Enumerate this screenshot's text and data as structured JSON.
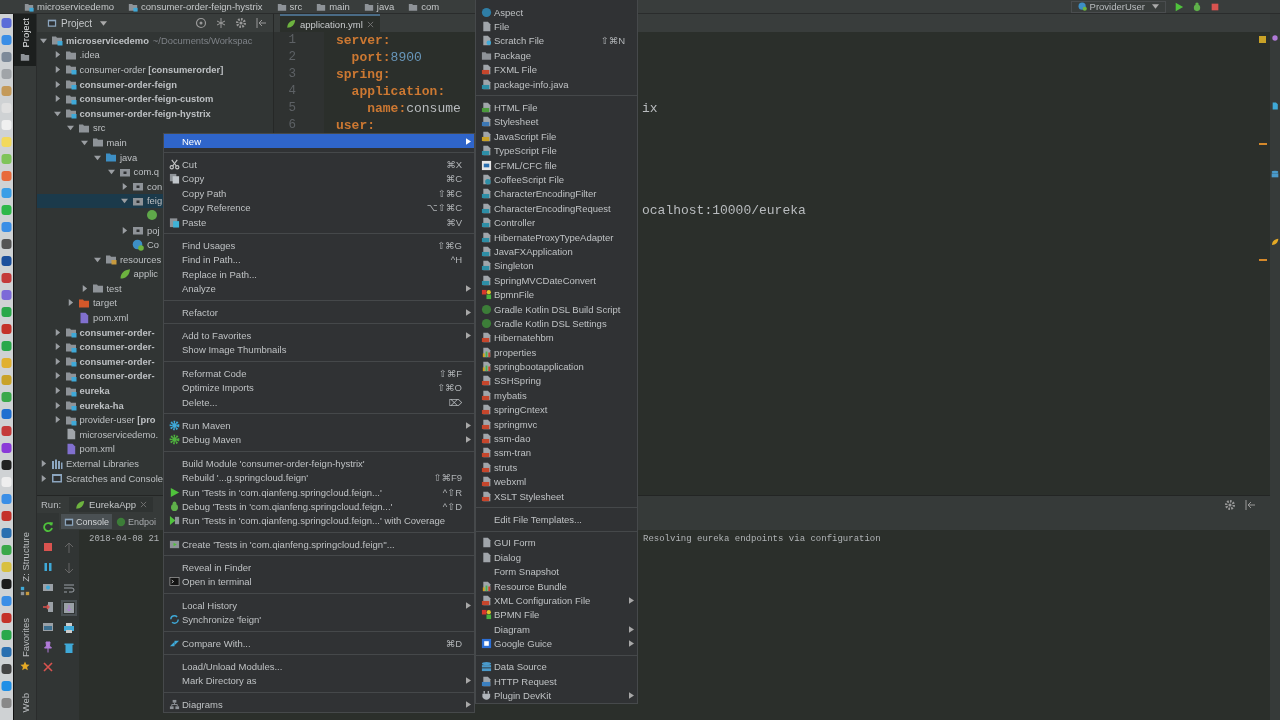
{
  "nav_bar": {
    "breadcrumbs": [
      "microservicedemo",
      "consumer-order-feign-hystrix",
      "src",
      "main",
      "java",
      "com"
    ],
    "run_config": "ProviderUser"
  },
  "left_stripe": {
    "top_tabs": [
      {
        "label": "Project",
        "selected": true
      }
    ],
    "bottom_tabs": [
      {
        "label": "Z: Structure",
        "selected": false
      },
      {
        "label": "Favorites",
        "selected": false
      },
      {
        "label": "Web",
        "selected": false
      }
    ]
  },
  "project_panel": {
    "title": "Project",
    "tree": [
      {
        "label": "microservicedemo",
        "path": "~/Documents/Workspac",
        "kind": "module",
        "bold": true,
        "expanded": true,
        "selected": false,
        "children": [
          {
            "label": ".idea",
            "kind": "folder",
            "bold": false,
            "expanded": false,
            "selected": false
          },
          {
            "label": "consumer-order **[consumerorder]**",
            "kind": "module",
            "bold": false,
            "expanded": false,
            "selected": false
          },
          {
            "label": "consumer-order-feign",
            "kind": "module",
            "bold": true,
            "expanded": false,
            "selected": false
          },
          {
            "label": "consumer-order-feign-custom",
            "kind": "module",
            "bold": true,
            "expanded": false,
            "selected": false
          },
          {
            "label": "consumer-order-feign-hystrix",
            "kind": "module",
            "bold": true,
            "expanded": true,
            "selected": false,
            "children": [
              {
                "label": "src",
                "kind": "folder",
                "bold": false,
                "expanded": true,
                "selected": false,
                "children": [
                  {
                    "label": "main",
                    "kind": "folder",
                    "bold": false,
                    "expanded": true,
                    "selected": false,
                    "children": [
                      {
                        "label": "java",
                        "kind": "source",
                        "bold": false,
                        "expanded": true,
                        "selected": false,
                        "children": [
                          {
                            "label": "com.q",
                            "kind": "package",
                            "bold": false,
                            "expanded": true,
                            "selected": false,
                            "children": [
                              {
                                "label": "con",
                                "kind": "package",
                                "bold": false,
                                "expanded": false,
                                "selected": false
                              },
                              {
                                "label": "feig",
                                "kind": "package",
                                "bold": false,
                                "expanded": true,
                                "selected": true,
                                "children": [
                                  {
                                    "kind": "interface",
                                    "selected": false
                                  }
                                ]
                              },
                              {
                                "label": "poj",
                                "kind": "package",
                                "bold": false,
                                "expanded": false,
                                "selected": false
                              },
                              {
                                "label": "Co",
                                "kind": "class",
                                "bold": false,
                                "selected": false
                              }
                            ]
                          }
                        ]
                      },
                      {
                        "label": "resources",
                        "kind": "resources",
                        "bold": false,
                        "expanded": true,
                        "selected": false,
                        "children": [
                          {
                            "label": "applic",
                            "kind": "config",
                            "bold": false,
                            "selected": false
                          }
                        ]
                      }
                    ]
                  },
                  {
                    "label": "test",
                    "kind": "folder",
                    "bold": false,
                    "expanded": false,
                    "selected": false
                  }
                ]
              },
              {
                "label": "target",
                "kind": "excluded",
                "bold": false,
                "expanded": false,
                "selected": false
              },
              {
                "label": "pom.xml",
                "kind": "maven",
                "bold": false,
                "selected": false
              }
            ]
          },
          {
            "label": "consumer-order-",
            "kind": "module",
            "bold": true,
            "expanded": false,
            "selected": false
          },
          {
            "label": "consumer-order-",
            "kind": "module",
            "bold": true,
            "expanded": false,
            "selected": false
          },
          {
            "label": "consumer-order-",
            "kind": "module",
            "bold": true,
            "expanded": false,
            "selected": false
          },
          {
            "label": "consumer-order-",
            "kind": "module",
            "bold": true,
            "expanded": false,
            "selected": false
          },
          {
            "label": "eureka",
            "kind": "module",
            "bold": true,
            "expanded": false,
            "selected": false
          },
          {
            "label": "eureka-ha",
            "kind": "module",
            "bold": true,
            "expanded": false,
            "selected": false
          },
          {
            "label": "provider-user **[pro**",
            "kind": "module",
            "bold": false,
            "expanded": false,
            "selected": false
          },
          {
            "label": "microservicedemo.",
            "kind": "iml",
            "bold": false,
            "selected": false
          },
          {
            "label": "pom.xml",
            "kind": "maven",
            "bold": false,
            "selected": false
          }
        ]
      },
      {
        "label": "External Libraries",
        "kind": "libraries",
        "bold": false,
        "expanded": false,
        "selected": false
      },
      {
        "label": "Scratches and Console",
        "kind": "scratches",
        "bold": false,
        "expanded": false,
        "selected": false
      }
    ]
  },
  "editor": {
    "tabs": [
      {
        "label": "application.yml",
        "selected": true
      }
    ],
    "lines": [
      {
        "number": "1",
        "key": "server:"
      },
      {
        "number": "2",
        "kind": "number",
        "key": "  port:",
        "value": "8900"
      },
      {
        "number": "3",
        "key": "spring:"
      },
      {
        "number": "4",
        "key": "  application:"
      },
      {
        "number": "5",
        "kind": "text",
        "key": "    name:",
        "value": "consume"
      },
      {
        "number": "6",
        "key": "user:"
      }
    ],
    "right_fragments": [
      "ix",
      "ocalhost:10000/eureka"
    ]
  },
  "run_panel": {
    "label": "Run:",
    "tabs": [
      {
        "label": "EurekaApp",
        "selected": true
      }
    ],
    "console_tabs": [
      {
        "label": "Console",
        "selected": true
      },
      {
        "label": "Endpoi",
        "selected": false
      }
    ],
    "console_lines": [
      {
        "left": "2018-04-08 21",
        "right": "Resolving eureka endpoints via configuration"
      }
    ]
  },
  "context_menu": {
    "items": [
      {
        "kind": "plain",
        "label": "New",
        "selected": true,
        "submenu": true
      },
      {
        "kind": "separator"
      },
      {
        "kind": "cut",
        "label": "Cut",
        "shortcut": "⌘X",
        "selected": false,
        "submenu": false
      },
      {
        "kind": "copy",
        "label": "Copy",
        "shortcut": "⌘C",
        "selected": false,
        "submenu": false
      },
      {
        "kind": "plain",
        "label": "Copy Path",
        "shortcut": "⇧⌘C",
        "selected": false,
        "submenu": false
      },
      {
        "kind": "plain",
        "label": "Copy Reference",
        "shortcut": "⌥⇧⌘C",
        "selected": false,
        "submenu": false
      },
      {
        "kind": "paste",
        "label": "Paste",
        "shortcut": "⌘V",
        "selected": false,
        "submenu": false
      },
      {
        "kind": "separator"
      },
      {
        "kind": "plain",
        "label": "Find Usages",
        "shortcut": "⇧⌘G",
        "selected": false,
        "submenu": false
      },
      {
        "kind": "plain",
        "label": "Find in Path...",
        "shortcut": "^H",
        "selected": false,
        "submenu": false
      },
      {
        "kind": "plain",
        "label": "Replace in Path...",
        "selected": false,
        "submenu": false
      },
      {
        "kind": "plain",
        "label": "Analyze",
        "selected": false,
        "submenu": true
      },
      {
        "kind": "separator"
      },
      {
        "kind": "plain",
        "label": "Refactor",
        "selected": false,
        "submenu": true
      },
      {
        "kind": "separator"
      },
      {
        "kind": "plain",
        "label": "Add to Favorites",
        "selected": false,
        "submenu": true
      },
      {
        "kind": "plain",
        "label": "Show Image Thumbnails",
        "selected": false,
        "submenu": false
      },
      {
        "kind": "separator"
      },
      {
        "kind": "plain",
        "label": "Reformat Code",
        "shortcut": "⇧⌘F",
        "selected": false,
        "submenu": false
      },
      {
        "kind": "plain",
        "label": "Optimize Imports",
        "shortcut": "⇧⌘O",
        "selected": false,
        "submenu": false
      },
      {
        "kind": "plain",
        "label": "Delete...",
        "shortcut": "⌦",
        "selected": false,
        "submenu": false
      },
      {
        "kind": "separator"
      },
      {
        "kind": "maven-run",
        "label": "Run Maven",
        "selected": false,
        "submenu": true
      },
      {
        "kind": "maven-debug",
        "label": "Debug Maven",
        "selected": false,
        "submenu": true
      },
      {
        "kind": "separator"
      },
      {
        "kind": "plain",
        "label": "Build Module 'consumer-order-feign-hystrix'",
        "selected": false,
        "submenu": false
      },
      {
        "kind": "plain",
        "label": "Rebuild '...g.springcloud.feign'",
        "shortcut": "⇧⌘F9",
        "selected": false,
        "submenu": false
      },
      {
        "kind": "run",
        "label": "Run 'Tests in 'com.qianfeng.springcloud.feign...'",
        "shortcut": "^⇧R",
        "selected": false,
        "submenu": false
      },
      {
        "kind": "debug",
        "label": "Debug 'Tests in 'com.qianfeng.springcloud.feign...'",
        "shortcut": "^⇧D",
        "selected": false,
        "submenu": false
      },
      {
        "kind": "coverage",
        "label": "Run 'Tests in 'com.qianfeng.springcloud.feign...' with Coverage",
        "selected": false,
        "submenu": false
      },
      {
        "kind": "separator"
      },
      {
        "kind": "test",
        "label": "Create 'Tests in 'com.qianfeng.springcloud.feign''...",
        "selected": false,
        "submenu": false
      },
      {
        "kind": "separator"
      },
      {
        "kind": "plain",
        "label": "Reveal in Finder",
        "selected": false,
        "submenu": false
      },
      {
        "kind": "terminal",
        "label": "Open in terminal",
        "selected": false,
        "submenu": false
      },
      {
        "kind": "separator"
      },
      {
        "kind": "plain",
        "label": "Local History",
        "selected": false,
        "submenu": true
      },
      {
        "kind": "sync",
        "label": "Synchronize 'feign'",
        "selected": false,
        "submenu": false
      },
      {
        "kind": "separator"
      },
      {
        "kind": "compare",
        "label": "Compare With...",
        "shortcut": "⌘D",
        "selected": false,
        "submenu": false
      },
      {
        "kind": "separator"
      },
      {
        "kind": "plain",
        "label": "Load/Unload Modules...",
        "selected": false,
        "submenu": false
      },
      {
        "kind": "plain",
        "label": "Mark Directory as",
        "selected": false,
        "submenu": true
      },
      {
        "kind": "separator"
      },
      {
        "kind": "diagram",
        "label": "Diagrams",
        "selected": false,
        "submenu": true
      }
    ]
  },
  "new_submenu": {
    "items": [
      {
        "kind": "aspect",
        "label": "Aspect",
        "selected": false,
        "submenu": false
      },
      {
        "kind": "file",
        "label": "File",
        "selected": false,
        "submenu": false
      },
      {
        "kind": "scratch",
        "label": "Scratch File",
        "shortcut": "⇧⌘N",
        "selected": false,
        "submenu": false
      },
      {
        "kind": "folder",
        "label": "Package",
        "selected": false,
        "submenu": false
      },
      {
        "kind": "tpl-red",
        "label": "FXML File",
        "selected": false,
        "submenu": false
      },
      {
        "kind": "tpl-teal",
        "label": "package-info.java",
        "selected": false,
        "submenu": false
      },
      {
        "kind": "separator"
      },
      {
        "kind": "tpl-green",
        "label": "HTML File",
        "selected": false,
        "submenu": false
      },
      {
        "kind": "tpl-blue",
        "label": "Stylesheet",
        "selected": false,
        "submenu": false
      },
      {
        "kind": "tpl-yellow",
        "label": "JavaScript File",
        "selected": false,
        "submenu": false
      },
      {
        "kind": "tpl-teal",
        "label": "TypeScript File",
        "selected": false,
        "submenu": false
      },
      {
        "kind": "cf",
        "label": "CFML/CFC file",
        "selected": false,
        "submenu": false
      },
      {
        "kind": "coffee",
        "label": "CoffeeScript File",
        "selected": false,
        "submenu": false
      },
      {
        "kind": "tpl-teal",
        "label": "CharacterEncodingFilter",
        "selected": false,
        "submenu": false
      },
      {
        "kind": "tpl-teal",
        "label": "CharacterEncodingRequest",
        "selected": false,
        "submenu": false
      },
      {
        "kind": "tpl-teal",
        "label": "Controller",
        "selected": false,
        "submenu": false
      },
      {
        "kind": "tpl-teal",
        "label": "HibernateProxyTypeAdapter",
        "selected": false,
        "submenu": false
      },
      {
        "kind": "tpl-teal",
        "label": "JavaFXApplication",
        "selected": false,
        "submenu": false
      },
      {
        "kind": "tpl-teal",
        "label": "Singleton",
        "selected": false,
        "submenu": false
      },
      {
        "kind": "tpl-teal",
        "label": "SpringMVCDateConvert",
        "selected": false,
        "submenu": false
      },
      {
        "kind": "bpmn",
        "label": "BpmnFile",
        "selected": false,
        "submenu": false
      },
      {
        "kind": "gradle",
        "label": "Gradle Kotlin DSL Build Script",
        "selected": false,
        "submenu": false
      },
      {
        "kind": "gradle",
        "label": "Gradle Kotlin DSL Settings",
        "selected": false,
        "submenu": false
      },
      {
        "kind": "tpl-red",
        "label": "Hibernatehbm",
        "selected": false,
        "submenu": false
      },
      {
        "kind": "tpl-chart",
        "label": "properties",
        "selected": false,
        "submenu": false
      },
      {
        "kind": "tpl-chart",
        "label": "springbootapplication",
        "selected": false,
        "submenu": false
      },
      {
        "kind": "tpl-red",
        "label": "SSHSpring",
        "selected": false,
        "submenu": false
      },
      {
        "kind": "tpl-red",
        "label": "mybatis",
        "selected": false,
        "submenu": false
      },
      {
        "kind": "tpl-red",
        "label": "springCntext",
        "selected": false,
        "submenu": false
      },
      {
        "kind": "tpl-red",
        "label": "springmvc",
        "selected": false,
        "submenu": false
      },
      {
        "kind": "tpl-red",
        "label": "ssm-dao",
        "selected": false,
        "submenu": false
      },
      {
        "kind": "tpl-red",
        "label": "ssm-tran",
        "selected": false,
        "submenu": false
      },
      {
        "kind": "tpl-red",
        "label": "struts",
        "selected": false,
        "submenu": false
      },
      {
        "kind": "tpl-red",
        "label": "webxml",
        "selected": false,
        "submenu": false
      },
      {
        "kind": "tpl-red",
        "label": "XSLT Stylesheet",
        "selected": false,
        "submenu": false
      },
      {
        "kind": "separator"
      },
      {
        "kind": "plain",
        "label": "Edit File Templates...",
        "selected": false,
        "submenu": false
      },
      {
        "kind": "separator"
      },
      {
        "kind": "file",
        "label": "GUI Form",
        "selected": false,
        "submenu": false
      },
      {
        "kind": "file",
        "label": "Dialog",
        "selected": false,
        "submenu": false
      },
      {
        "kind": "plain",
        "label": "Form Snapshot",
        "selected": false,
        "submenu": false
      },
      {
        "kind": "tpl-chart",
        "label": "Resource Bundle",
        "selected": false,
        "submenu": false
      },
      {
        "kind": "tpl-red",
        "label": "XML Configuration File",
        "selected": false,
        "submenu": true
      },
      {
        "kind": "bpmn",
        "label": "BPMN File",
        "selected": false,
        "submenu": false
      },
      {
        "kind": "plain",
        "label": "Diagram",
        "selected": false,
        "submenu": true
      },
      {
        "kind": "google",
        "label": "Google Guice",
        "selected": false,
        "submenu": true
      },
      {
        "kind": "separator"
      },
      {
        "kind": "db",
        "label": "Data Source",
        "selected": false,
        "submenu": false
      },
      {
        "kind": "http",
        "label": "HTTP Request",
        "selected": false,
        "submenu": false
      },
      {
        "kind": "plugin",
        "label": "Plugin DevKit",
        "selected": false,
        "submenu": true
      }
    ]
  }
}
